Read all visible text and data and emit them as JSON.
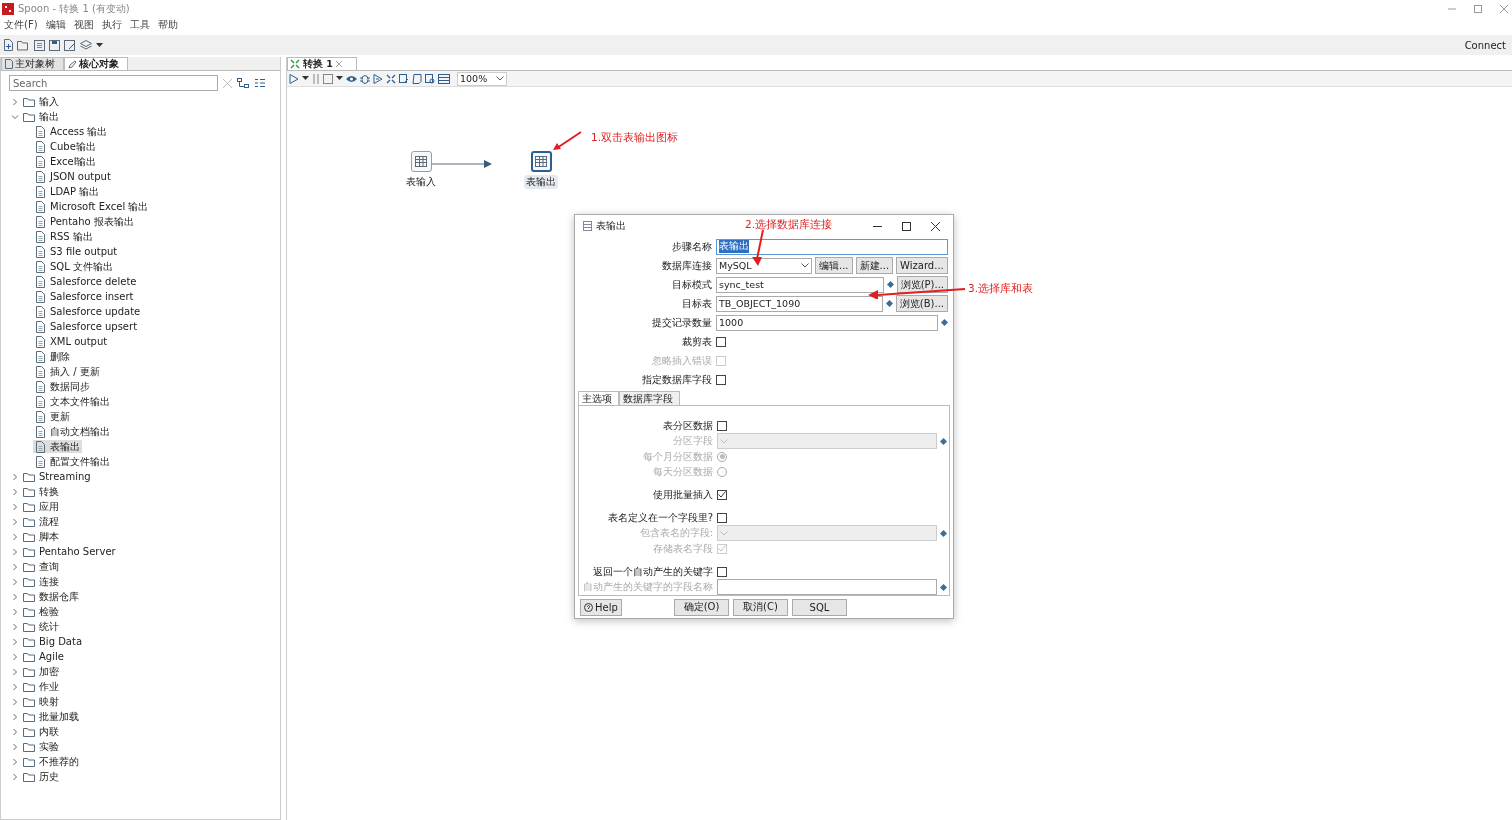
{
  "window": {
    "title": "Spoon - 转换 1 (有变动)"
  },
  "menu": [
    "文件(F)",
    "编辑",
    "视图",
    "执行",
    "工具",
    "帮助"
  ],
  "toolbar": {
    "connect": "Connect"
  },
  "left_panel": {
    "tabs": [
      {
        "label": "主对象树",
        "selected": false
      },
      {
        "label": "核心对象",
        "selected": true
      }
    ],
    "search": {
      "placeholder": "Search"
    },
    "tree": [
      {
        "label": "输入",
        "expanded": false,
        "selected": false
      },
      {
        "label": "输出",
        "expanded": true,
        "selected": false,
        "children": [
          {
            "label": "Access 输出",
            "selected": false
          },
          {
            "label": "Cube输出",
            "selected": false
          },
          {
            "label": "Excel输出",
            "selected": false
          },
          {
            "label": "JSON output",
            "selected": false
          },
          {
            "label": "LDAP 输出",
            "selected": false
          },
          {
            "label": "Microsoft Excel 输出",
            "selected": false
          },
          {
            "label": "Pentaho 报表输出",
            "selected": false
          },
          {
            "label": "RSS 输出",
            "selected": false
          },
          {
            "label": "S3 file output",
            "selected": false
          },
          {
            "label": "SQL 文件输出",
            "selected": false
          },
          {
            "label": "Salesforce delete",
            "selected": false
          },
          {
            "label": "Salesforce insert",
            "selected": false
          },
          {
            "label": "Salesforce update",
            "selected": false
          },
          {
            "label": "Salesforce upsert",
            "selected": false
          },
          {
            "label": "XML output",
            "selected": false
          },
          {
            "label": "删除",
            "selected": false
          },
          {
            "label": "插入 / 更新",
            "selected": false
          },
          {
            "label": "数据同步",
            "selected": false
          },
          {
            "label": "文本文件输出",
            "selected": false
          },
          {
            "label": "更新",
            "selected": false
          },
          {
            "label": "自动文档输出",
            "selected": false
          },
          {
            "label": "表输出",
            "selected": true
          },
          {
            "label": "配置文件输出",
            "selected": false
          }
        ]
      },
      {
        "label": "Streaming",
        "expanded": false,
        "selected": false
      },
      {
        "label": "转换",
        "expanded": false,
        "selected": false
      },
      {
        "label": "应用",
        "expanded": false,
        "selected": false
      },
      {
        "label": "流程",
        "expanded": false,
        "selected": false
      },
      {
        "label": "脚本",
        "expanded": false,
        "selected": false
      },
      {
        "label": "Pentaho Server",
        "expanded": false,
        "selected": false
      },
      {
        "label": "查询",
        "expanded": false,
        "selected": false
      },
      {
        "label": "连接",
        "expanded": false,
        "selected": false
      },
      {
        "label": "数据仓库",
        "expanded": false,
        "selected": false
      },
      {
        "label": "检验",
        "expanded": false,
        "selected": false
      },
      {
        "label": "统计",
        "expanded": false,
        "selected": false
      },
      {
        "label": "Big Data",
        "expanded": false,
        "selected": false
      },
      {
        "label": "Agile",
        "expanded": false,
        "selected": false
      },
      {
        "label": "加密",
        "expanded": false,
        "selected": false
      },
      {
        "label": "作业",
        "expanded": false,
        "selected": false
      },
      {
        "label": "映射",
        "expanded": false,
        "selected": false
      },
      {
        "label": "批量加载",
        "expanded": false,
        "selected": false
      },
      {
        "label": "内联",
        "expanded": false,
        "selected": false
      },
      {
        "label": "实验",
        "expanded": false,
        "selected": false
      },
      {
        "label": "不推荐的",
        "expanded": false,
        "selected": false
      },
      {
        "label": "历史",
        "expanded": false,
        "selected": false
      }
    ]
  },
  "editor": {
    "tabs": [
      {
        "label": "转换 1",
        "selected": true
      }
    ],
    "zoom": "100%",
    "nodes": [
      {
        "label": "表输入",
        "selected": false
      },
      {
        "label": "表输出",
        "selected": true
      }
    ]
  },
  "annotations": [
    {
      "text": "1.双击表输出图标"
    },
    {
      "text": "2.选择数据库连接"
    },
    {
      "text": "3.选择库和表"
    }
  ],
  "dialog": {
    "title": "表输出",
    "fields": [
      {
        "kind": "text",
        "label": "步骤名称",
        "value": "表输出",
        "text_selected": true,
        "disabled": false
      },
      {
        "kind": "combo",
        "label": "数据库连接",
        "value": "MySQL",
        "disabled": false,
        "buttons": [
          "编辑...",
          "新建...",
          "Wizard..."
        ]
      },
      {
        "kind": "text",
        "label": "目标模式",
        "value": "sync_test",
        "text_selected": false,
        "disabled": false,
        "variable": true,
        "buttons": [
          "浏览(P)..."
        ]
      },
      {
        "kind": "text",
        "label": "目标表",
        "value": "TB_OBJECT_1090",
        "text_selected": false,
        "disabled": false,
        "variable": true,
        "buttons": [
          "浏览(B)..."
        ]
      },
      {
        "kind": "text",
        "label": "提交记录数量",
        "value": "1000",
        "text_selected": false,
        "disabled": false,
        "variable": true
      },
      {
        "kind": "checkbox",
        "label": "裁剪表",
        "checked": false,
        "disabled": false
      },
      {
        "kind": "checkbox",
        "label": "忽略插入错误",
        "checked": false,
        "disabled": true
      },
      {
        "kind": "checkbox",
        "label": "指定数据库字段",
        "checked": false,
        "disabled": false
      }
    ],
    "tabs": [
      {
        "label": "主选项",
        "selected": true
      },
      {
        "label": "数据库字段",
        "selected": false
      }
    ],
    "option_groups": [
      [
        {
          "kind": "checkbox",
          "label": "表分区数据",
          "checked": false,
          "disabled": false
        },
        {
          "kind": "combo",
          "label": "分区字段",
          "disabled": true,
          "variable": true
        },
        {
          "kind": "radio",
          "label": "每个月分区数据",
          "checked": true,
          "disabled": true
        },
        {
          "kind": "radio",
          "label": "每天分区数据",
          "checked": false,
          "disabled": true
        }
      ],
      [
        {
          "kind": "checkbox",
          "label": "使用批量插入",
          "checked": true,
          "disabled": false
        }
      ],
      [
        {
          "kind": "checkbox",
          "label": "表名定义在一个字段里?",
          "checked": false,
          "disabled": false
        },
        {
          "kind": "combo",
          "label": "包含表名的字段:",
          "disabled": true,
          "variable": true
        },
        {
          "kind": "checkbox",
          "label": "存储表名字段",
          "checked": true,
          "disabled": true
        }
      ],
      [
        {
          "kind": "checkbox",
          "label": "返回一个自动产生的关键字",
          "checked": false,
          "disabled": false
        },
        {
          "kind": "text",
          "label": "自动产生的关键字的字段名称",
          "label_disabled": true,
          "disabled": false,
          "text_selected": false,
          "variable": true
        }
      ]
    ],
    "help": "Help",
    "actions": [
      "确定(O)",
      "取消(C)",
      "SQL"
    ]
  }
}
